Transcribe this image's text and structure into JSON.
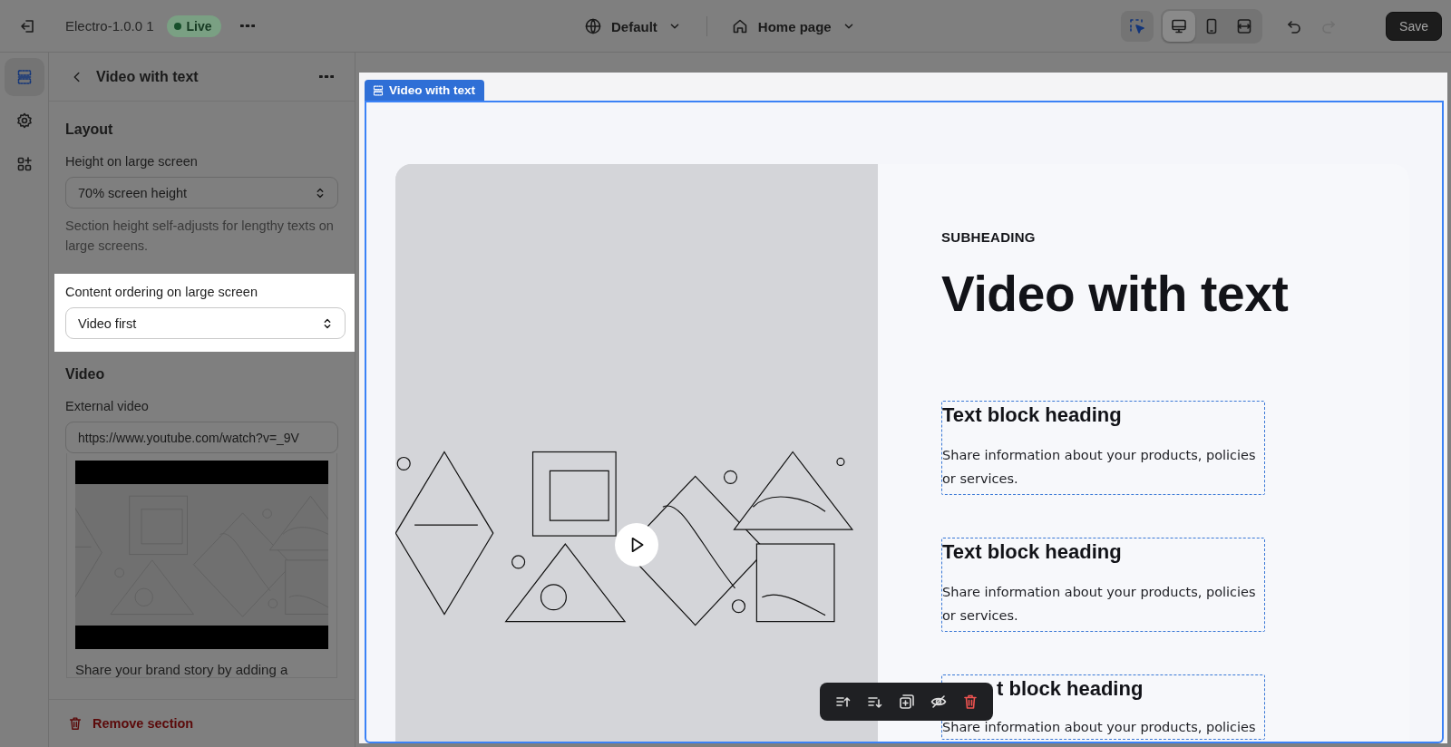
{
  "topbar": {
    "theme_name": "Electro-1.0.0 1",
    "status": "Live",
    "locale": "Default",
    "page": "Home page",
    "tools": [
      {
        "kind": "inspect",
        "selected": true
      },
      {
        "kind": "desktop",
        "selected": true
      },
      {
        "kind": "mobile",
        "selected": false
      },
      {
        "kind": "fullwidth",
        "selected": false
      }
    ],
    "history": [
      {
        "kind": "undo",
        "disabled": false
      },
      {
        "kind": "redo",
        "disabled": true
      }
    ],
    "save": "Save"
  },
  "rail": [
    {
      "kind": "sections",
      "selected": true
    },
    {
      "kind": "settings",
      "selected": false
    },
    {
      "kind": "apps",
      "selected": false
    }
  ],
  "panel": {
    "title": "Video with text",
    "groups": [
      {
        "heading": "Layout",
        "fields": [
          {
            "kind": "select",
            "label": "Height on large screen",
            "value": "70% screen height",
            "help": "Section height self-adjusts for lengthy texts on large screens."
          },
          {
            "kind": "select",
            "label": "Content ordering on large screen",
            "value": "Video first",
            "highlighted": true
          }
        ]
      },
      {
        "heading": "Video",
        "fields": [
          {
            "kind": "video",
            "label": "External video",
            "value": "https://www.youtube.com/watch?v=_9V"
          }
        ]
      }
    ],
    "more_text": "Share your brand story by adding a",
    "remove": "Remove section"
  },
  "preview": {
    "tab": "Video with text",
    "subheading": "SUBHEADING",
    "heading": "Video with text",
    "blocks": [
      {
        "heading": "Text block heading",
        "text": "Share information about your products, policies or services."
      },
      {
        "heading": "Text block heading",
        "text": "Share information about your products, policies or services."
      },
      {
        "heading": "t block heading",
        "text": "Share information about your products, policies"
      }
    ],
    "toolbar": [
      {
        "kind": "move-up"
      },
      {
        "kind": "move-down"
      },
      {
        "kind": "duplicate"
      },
      {
        "kind": "hide"
      },
      {
        "kind": "delete"
      }
    ]
  }
}
